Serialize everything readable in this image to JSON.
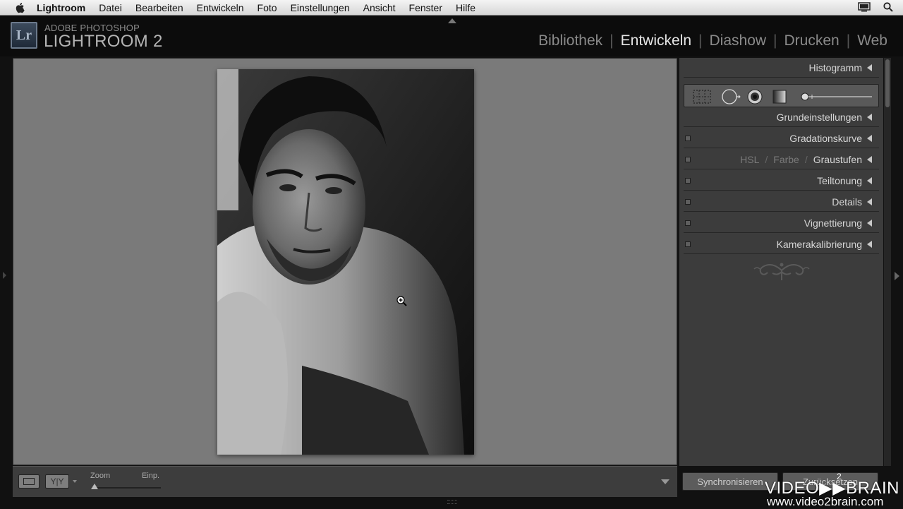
{
  "menubar": {
    "app_name": "Lightroom",
    "items": [
      "Datei",
      "Bearbeiten",
      "Entwickeln",
      "Foto",
      "Einstellungen",
      "Ansicht",
      "Fenster",
      "Hilfe"
    ]
  },
  "identity": {
    "logo_text": "Lr",
    "line1": "ADOBE PHOTOSHOP",
    "line2": "LIGHTROOM 2"
  },
  "modules": {
    "items": [
      {
        "label": "Bibliothek",
        "active": false
      },
      {
        "label": "Entwickeln",
        "active": true
      },
      {
        "label": "Diashow",
        "active": false
      },
      {
        "label": "Drucken",
        "active": false
      },
      {
        "label": "Web",
        "active": false
      }
    ]
  },
  "right_panel": {
    "histogram": "Histogramm",
    "basic": "Grundeinstellungen",
    "tone_curve": "Gradationskurve",
    "hsl": {
      "part1": "HSL",
      "part2": "Farbe",
      "part3": "Graustufen"
    },
    "split_toning": "Teiltonung",
    "details": "Details",
    "vignette": "Vignettierung",
    "camera_calibration": "Kamerakalibrierung"
  },
  "toolbar": {
    "zoom_label": "Zoom",
    "fit_label": "Einp.",
    "yy_label": "Y|Y"
  },
  "buttons": {
    "sync": "Synchronisieren",
    "reset": "Zurücksetzen"
  },
  "watermark": {
    "brand": "VIDEO▶▶BRAIN",
    "badge": "2",
    "url": "www.video2brain.com"
  },
  "colors": {
    "background": "#111111",
    "image_area": "#7a7a7a",
    "panel": "#3c3c3c",
    "active_module": "#e6e6e6",
    "inactive_module": "#8a8a8a"
  }
}
